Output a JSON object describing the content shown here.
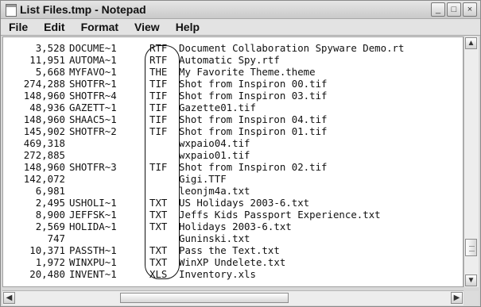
{
  "window": {
    "title": "List Files.tmp - Notepad",
    "buttons": [
      "_",
      "□",
      "×"
    ]
  },
  "menu": [
    "File",
    "Edit",
    "Format",
    "View",
    "Help"
  ],
  "lines": [
    {
      "size": "3,528",
      "short": "DOCUME~1",
      "ext": "RTF",
      "long": "Document Collaboration Spyware Demo.rt"
    },
    {
      "size": "11,951",
      "short": "AUTOMA~1",
      "ext": "RTF",
      "long": "Automatic Spy.rtf"
    },
    {
      "size": "5,668",
      "short": "MYFAVO~1",
      "ext": "THE",
      "long": "My Favorite Theme.theme"
    },
    {
      "size": "274,288",
      "short": "SHOTFR~1",
      "ext": "TIF",
      "long": "Shot from Inspiron 00.tif"
    },
    {
      "size": "148,960",
      "short": "SHOTFR~4",
      "ext": "TIF",
      "long": "Shot from Inspiron 03.tif"
    },
    {
      "size": "48,936",
      "short": "GAZETT~1",
      "ext": "TIF",
      "long": "Gazette01.tif"
    },
    {
      "size": "148,960",
      "short": "SHAAC5~1",
      "ext": "TIF",
      "long": "Shot from Inspiron 04.tif"
    },
    {
      "size": "145,902",
      "short": "SHOTFR~2",
      "ext": "TIF",
      "long": "Shot from Inspiron 01.tif"
    },
    {
      "size": "469,318",
      "short": "",
      "ext": "",
      "long": "wxpaio04.tif"
    },
    {
      "size": "272,885",
      "short": "",
      "ext": "",
      "long": "wxpaio01.tif"
    },
    {
      "size": "148,960",
      "short": "SHOTFR~3",
      "ext": "TIF",
      "long": "Shot from Inspiron 02.tif"
    },
    {
      "size": "142,072",
      "short": "",
      "ext": "",
      "long": "Gigi.TTF"
    },
    {
      "size": "6,981",
      "short": "",
      "ext": "",
      "long": "leonjm4a.txt"
    },
    {
      "size": "2,495",
      "short": "USHOLI~1",
      "ext": "TXT",
      "long": "US Holidays 2003-6.txt"
    },
    {
      "size": "8,900",
      "short": "JEFFSK~1",
      "ext": "TXT",
      "long": "Jeffs Kids Passport Experience.txt"
    },
    {
      "size": "2,569",
      "short": "HOLIDA~1",
      "ext": "TXT",
      "long": "Holidays 2003-6.txt"
    },
    {
      "size": "747",
      "short": "",
      "ext": "",
      "long": "Guninski.txt"
    },
    {
      "size": "10,371",
      "short": "PASSTH~1",
      "ext": "TXT",
      "long": "Pass the Text.txt"
    },
    {
      "size": "1,972",
      "short": "WINXPU~1",
      "ext": "TXT",
      "long": "WinXP Undelete.txt"
    },
    {
      "size": "20,480",
      "short": "INVENT~1",
      "ext": "XLS",
      "long": "Inventory.xls"
    }
  ],
  "scrollbar": {
    "up": "▲",
    "down": "▼",
    "left": "◀",
    "right": "▶"
  }
}
